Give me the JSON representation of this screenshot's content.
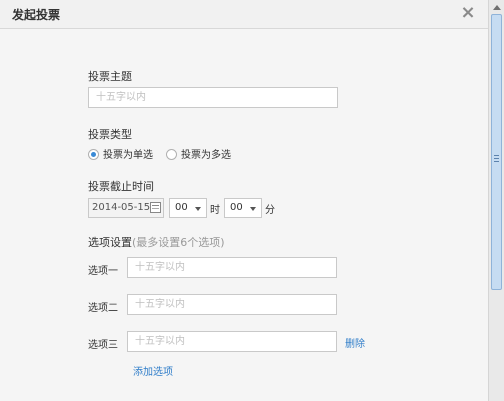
{
  "dialog": {
    "title": "发起投票",
    "close_symbol": "×"
  },
  "form": {
    "subject_label": "投票主题",
    "subject_placeholder": "十五字以内",
    "type_label": "投票类型",
    "type_options": [
      {
        "label": "投票为单选",
        "checked": true
      },
      {
        "label": "投票为多选",
        "checked": false
      }
    ],
    "deadline_label": "投票截止时间",
    "deadline_date": "2014-05-15",
    "hour_value": "00",
    "hour_unit": "时",
    "minute_value": "00",
    "minute_unit": "分",
    "options_label": "选项设置",
    "options_hint": "(最多设置6个选项)",
    "options": [
      {
        "label": "选项一",
        "placeholder": "十五字以内"
      },
      {
        "label": "选项二",
        "placeholder": "十五字以内"
      },
      {
        "label": "选项三",
        "placeholder": "十五字以内"
      }
    ],
    "delete_label": "删除",
    "add_option_label": "添加选项"
  },
  "icons": {
    "close": "close-icon",
    "calendar": "calendar-icon",
    "dropdown": "chevron-down-icon",
    "scroll_up": "scroll-up-arrow-icon"
  },
  "colors": {
    "link": "#2f7dc9",
    "radio_selected": "#3a8ad6",
    "background": "#f5f5f5"
  }
}
